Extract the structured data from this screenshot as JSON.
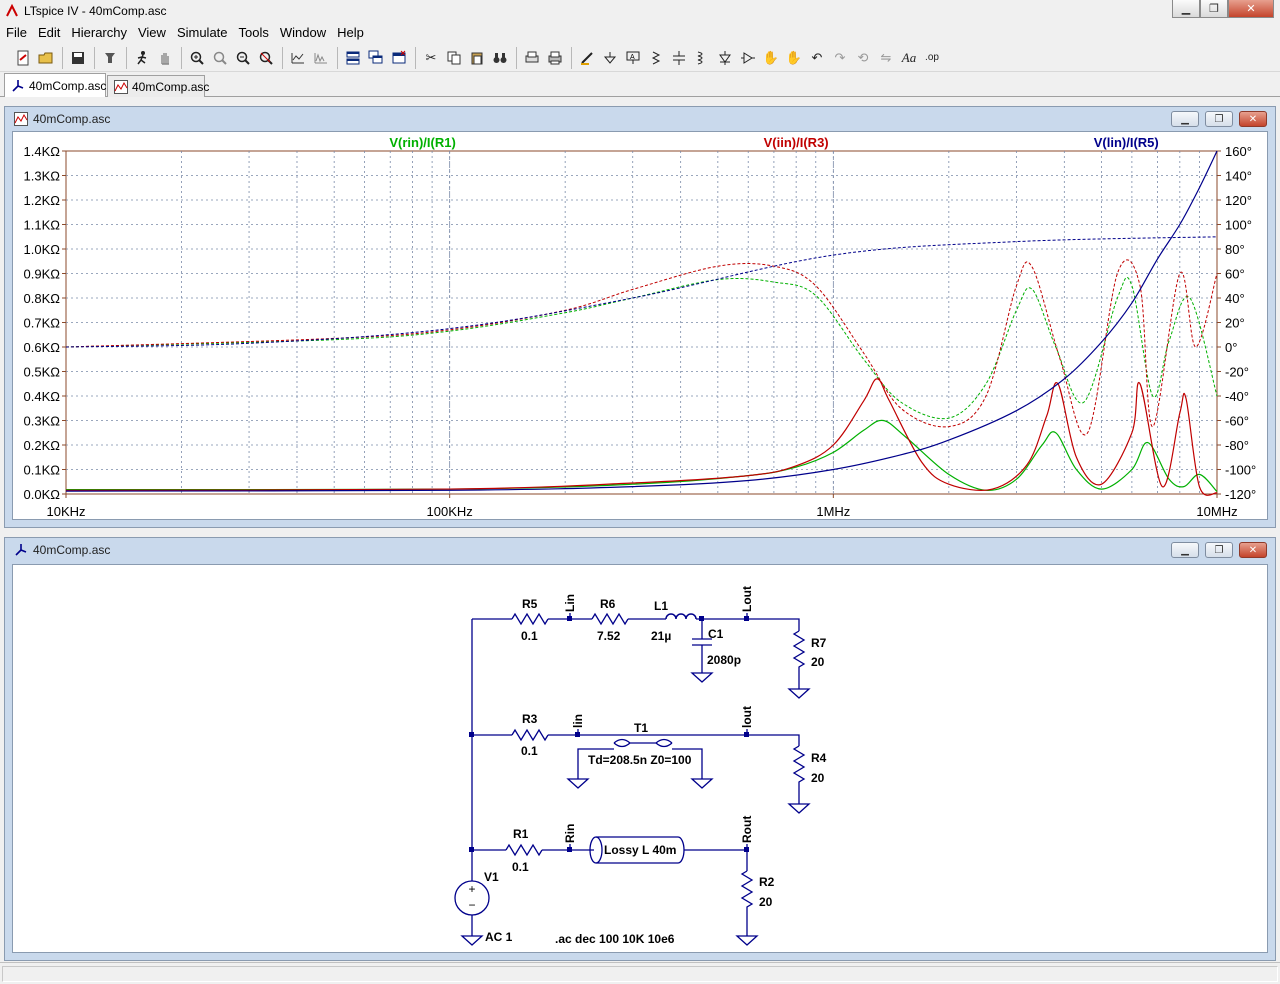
{
  "window": {
    "title": "LTspice IV - 40mComp.asc",
    "controls": [
      "minimize-icon",
      "restore-icon",
      "close-icon"
    ]
  },
  "menu": [
    "File",
    "Edit",
    "Hierarchy",
    "View",
    "Simulate",
    "Tools",
    "Window",
    "Help"
  ],
  "tabs": [
    {
      "label": "40mComp.asc",
      "icon": "schematic-icon",
      "active": true
    },
    {
      "label": "40mComp.asc",
      "icon": "waveform-icon",
      "active": false
    }
  ],
  "plot_window": {
    "title": "40mComp.asc",
    "icon": "waveform-icon"
  },
  "schematic_window": {
    "title": "40mComp.asc",
    "icon": "schematic-icon"
  },
  "colors": {
    "green": "#00b000",
    "red": "#c00000",
    "blue": "#00008b",
    "axis": "#8b4a2b",
    "grid": "#7a8aa8"
  },
  "chart_data": {
    "type": "line",
    "x_scale": "log",
    "xlim": [
      10000,
      10000000
    ],
    "x_ticks": [
      "10KHz",
      "100KHz",
      "1MHz",
      "10MHz"
    ],
    "y_left_ticks": [
      "1.4KΩ",
      "1.3KΩ",
      "1.2KΩ",
      "1.1KΩ",
      "1.0KΩ",
      "0.9KΩ",
      "0.8KΩ",
      "0.7KΩ",
      "0.6KΩ",
      "0.5KΩ",
      "0.4KΩ",
      "0.3KΩ",
      "0.2KΩ",
      "0.1KΩ",
      "0.0KΩ"
    ],
    "y_right_ticks": [
      "160°",
      "140°",
      "120°",
      "100°",
      "80°",
      "60°",
      "40°",
      "20°",
      "0°",
      "-20°",
      "-40°",
      "-60°",
      "-80°",
      "-100°",
      "-120°"
    ],
    "ylim_magnitude_ohm": [
      0,
      1400
    ],
    "ylim_phase_deg": [
      -120,
      160
    ],
    "series": [
      {
        "name": "V(rin)/I(R1)",
        "color": "#00b000",
        "magnitude": [
          [
            10000,
            18
          ],
          [
            100000,
            20
          ],
          [
            300000,
            40
          ],
          [
            600000,
            75
          ],
          [
            800000,
            110
          ],
          [
            1000000,
            170
          ],
          [
            1200000,
            260
          ],
          [
            1350000,
            300
          ],
          [
            1550000,
            230
          ],
          [
            2000000,
            80
          ],
          [
            2500000,
            15
          ],
          [
            3000000,
            60
          ],
          [
            3500000,
            200
          ],
          [
            3800000,
            250
          ],
          [
            4300000,
            100
          ],
          [
            5000000,
            20
          ],
          [
            6000000,
            100
          ],
          [
            6600000,
            210
          ],
          [
            7500000,
            60
          ],
          [
            8200000,
            30
          ],
          [
            9000000,
            80
          ],
          [
            10000000,
            10
          ]
        ],
        "phase": [
          [
            10000,
            0
          ],
          [
            50000,
            6
          ],
          [
            100000,
            13
          ],
          [
            200000,
            28
          ],
          [
            300000,
            40
          ],
          [
            500000,
            55
          ],
          [
            700000,
            53
          ],
          [
            900000,
            42
          ],
          [
            1200000,
            -10
          ],
          [
            1500000,
            -45
          ],
          [
            2000000,
            -58
          ],
          [
            2500000,
            -30
          ],
          [
            3000000,
            30
          ],
          [
            3300000,
            47
          ],
          [
            3800000,
            0
          ],
          [
            4500000,
            -45
          ],
          [
            5500000,
            40
          ],
          [
            6000000,
            50
          ],
          [
            6800000,
            -40
          ],
          [
            7500000,
            5
          ],
          [
            8500000,
            40
          ],
          [
            10000000,
            -40
          ]
        ]
      },
      {
        "name": "V(iin)/I(R3)",
        "color": "#c00000",
        "magnitude": [
          [
            10000,
            15
          ],
          [
            100000,
            20
          ],
          [
            300000,
            45
          ],
          [
            600000,
            75
          ],
          [
            800000,
            115
          ],
          [
            1000000,
            200
          ],
          [
            1200000,
            380
          ],
          [
            1300000,
            470
          ],
          [
            1400000,
            380
          ],
          [
            1700000,
            130
          ],
          [
            2000000,
            40
          ],
          [
            2600000,
            20
          ],
          [
            3200000,
            120
          ],
          [
            3600000,
            320
          ],
          [
            3850000,
            450
          ],
          [
            4300000,
            150
          ],
          [
            5000000,
            40
          ],
          [
            6000000,
            250
          ],
          [
            6300000,
            450
          ],
          [
            7200000,
            30
          ],
          [
            8000000,
            330
          ],
          [
            8300000,
            390
          ],
          [
            9000000,
            30
          ],
          [
            10000000,
            5
          ]
        ],
        "phase": [
          [
            10000,
            0
          ],
          [
            50000,
            7
          ],
          [
            100000,
            14
          ],
          [
            200000,
            30
          ],
          [
            300000,
            47
          ],
          [
            500000,
            66
          ],
          [
            700000,
            66
          ],
          [
            900000,
            50
          ],
          [
            1200000,
            -5
          ],
          [
            1500000,
            -50
          ],
          [
            2000000,
            -65
          ],
          [
            2500000,
            -40
          ],
          [
            3000000,
            50
          ],
          [
            3300000,
            65
          ],
          [
            3900000,
            -10
          ],
          [
            4600000,
            -70
          ],
          [
            5500000,
            60
          ],
          [
            6300000,
            50
          ],
          [
            6800000,
            -65
          ],
          [
            8000000,
            60
          ],
          [
            8800000,
            0
          ],
          [
            10000000,
            60
          ]
        ]
      },
      {
        "name": "V(lin)/I(R5)",
        "color": "#00008b",
        "magnitude": [
          [
            10000,
            12
          ],
          [
            100000,
            15
          ],
          [
            300000,
            30
          ],
          [
            600000,
            55
          ],
          [
            1000000,
            100
          ],
          [
            1500000,
            160
          ],
          [
            2000000,
            220
          ],
          [
            3000000,
            340
          ],
          [
            4000000,
            470
          ],
          [
            5000000,
            620
          ],
          [
            6000000,
            780
          ],
          [
            7000000,
            960
          ],
          [
            8000000,
            1100
          ],
          [
            9000000,
            1250
          ],
          [
            10000000,
            1400
          ]
        ],
        "phase": [
          [
            10000,
            0
          ],
          [
            30000,
            3
          ],
          [
            100000,
            15
          ],
          [
            300000,
            40
          ],
          [
            1000000,
            75
          ],
          [
            3000000,
            86
          ],
          [
            10000000,
            90
          ]
        ]
      }
    ]
  },
  "schematic": {
    "labels": {
      "R5": "R5",
      "R5_val": "0.1",
      "R6": "R6",
      "R6_val": "7.52",
      "L1": "L1",
      "L1_val": "21µ",
      "C1": "C1",
      "C1_val": "2080p",
      "R7": "R7",
      "R7_val": "20",
      "R3": "R3",
      "R3_val": "0.1",
      "T1": "T1",
      "T1_val": "Td=208.5n Z0=100",
      "R4": "R4",
      "R4_val": "20",
      "R1": "R1",
      "R1_val": "0.1",
      "lossy": "Lossy L 40m",
      "R2": "R2",
      "R2_val": "20",
      "V1": "V1",
      "V1_val": "AC 1",
      "directive": ".ac dec 100 10K 10e6",
      "net_Lin": "Lin",
      "net_Lout": "Lout",
      "net_lin": "lin",
      "net_lout": "lout",
      "net_Rin": "Rin",
      "net_Rout": "Rout"
    }
  }
}
